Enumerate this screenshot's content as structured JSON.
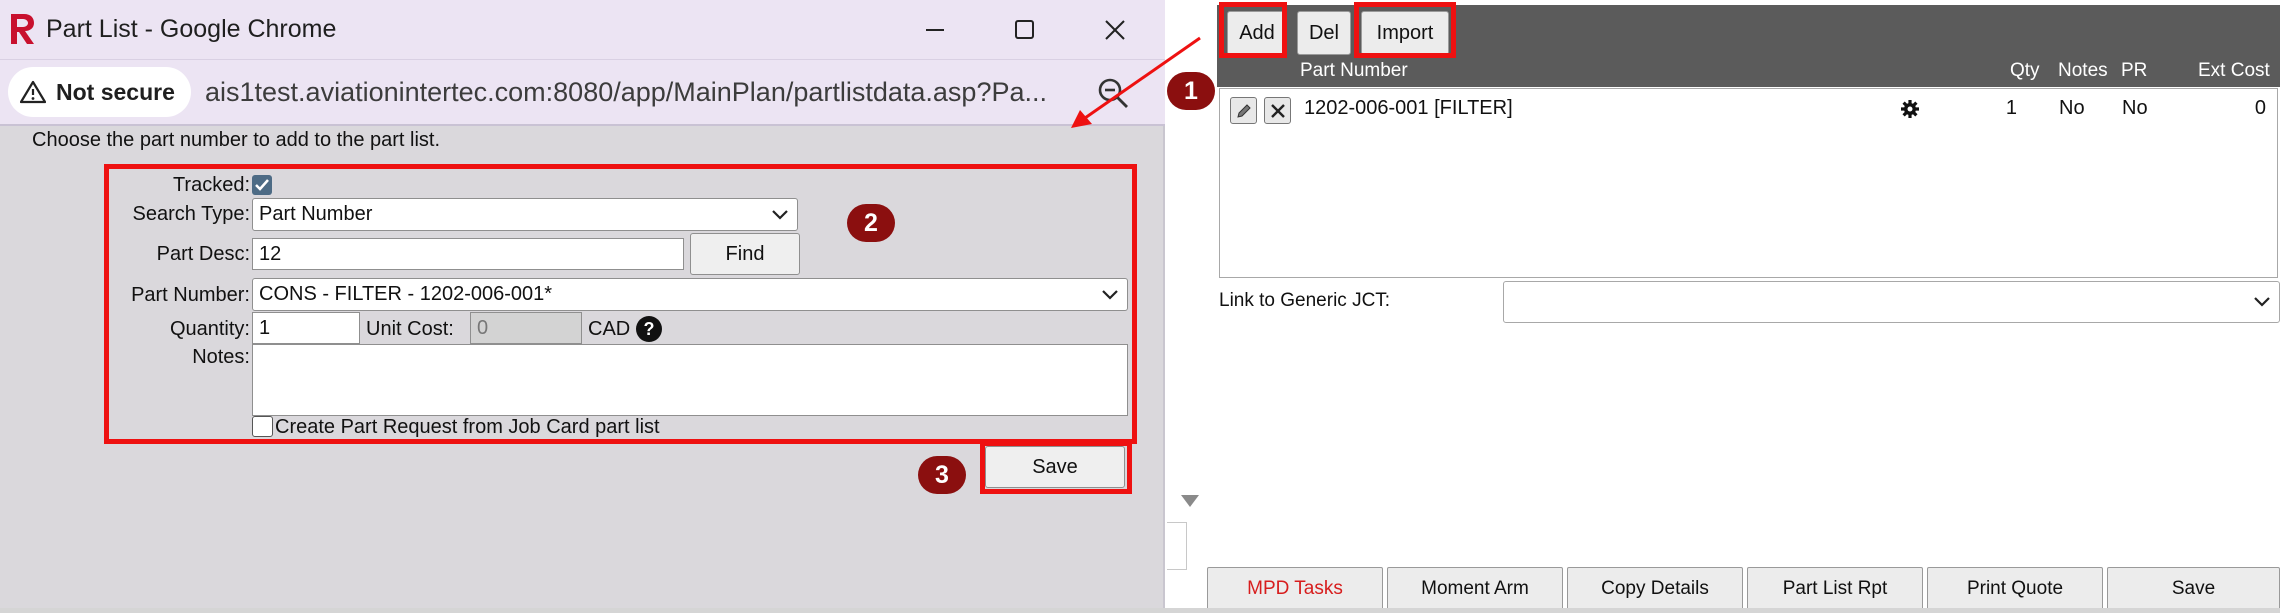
{
  "popup": {
    "window_title": "Part List - Google Chrome",
    "security_label": "Not secure",
    "url": "ais1test.aviationintertec.com:8080/app/MainPlan/partlistdata.asp?Pa...",
    "instructions": "Choose the part number to add to the part list.",
    "form": {
      "tracked_label": "Tracked:",
      "tracked_checked": true,
      "search_type_label": "Search Type:",
      "search_type_value": "Part Number",
      "part_desc_label": "Part Desc:",
      "part_desc_value": "12",
      "find_label": "Find",
      "part_number_label": "Part Number:",
      "part_number_value": "CONS - FILTER - 1202-006-001*",
      "quantity_label": "Quantity:",
      "quantity_value": "1",
      "unit_cost_label": "Unit Cost:",
      "unit_cost_value": "0",
      "currency": "CAD",
      "help_glyph": "?",
      "notes_label": "Notes:",
      "notes_value": "",
      "create_pr_label": "Create Part Request from Job Card part list",
      "create_pr_checked": false,
      "save_label": "Save"
    }
  },
  "annotations": {
    "badge_1": "1",
    "badge_2": "2",
    "badge_3": "3",
    "color": "#ee1111",
    "badge_color": "#8b0f0f"
  },
  "app": {
    "toolbar": {
      "add": "Add",
      "del": "Del",
      "import": "Import"
    },
    "grid": {
      "columns": [
        "Part Number",
        "Qty",
        "Notes",
        "PR",
        "Ext Cost"
      ],
      "rows": [
        {
          "part_number": "1202-006-001 [FILTER]",
          "qty": "1",
          "notes": "No",
          "pr": "No",
          "ext_cost": "0"
        }
      ]
    },
    "link_generic_jct_label": "Link to Generic JCT:",
    "link_generic_jct_value": "",
    "footer_buttons": [
      "MPD Tasks",
      "Moment Arm",
      "Copy Details",
      "Part List Rpt",
      "Print Quote",
      "Save"
    ],
    "accent_red": "#d71d1d",
    "header_bg": "#5b5b5b"
  }
}
